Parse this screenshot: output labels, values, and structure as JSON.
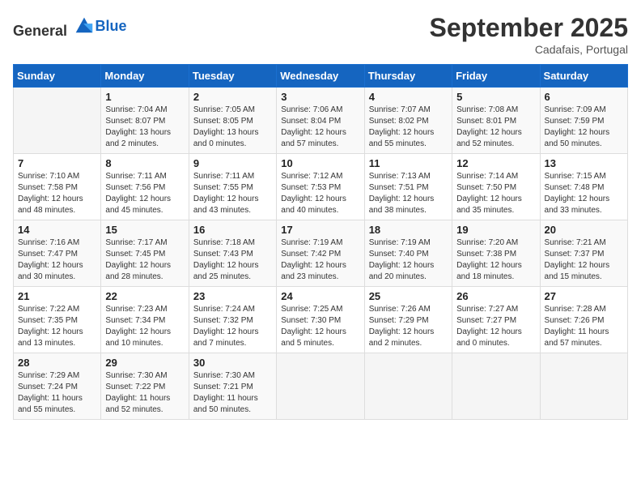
{
  "header": {
    "logo_general": "General",
    "logo_blue": "Blue",
    "month_title": "September 2025",
    "location": "Cadafais, Portugal"
  },
  "weekdays": [
    "Sunday",
    "Monday",
    "Tuesday",
    "Wednesday",
    "Thursday",
    "Friday",
    "Saturday"
  ],
  "weeks": [
    [
      {
        "day": "",
        "info": ""
      },
      {
        "day": "1",
        "info": "Sunrise: 7:04 AM\nSunset: 8:07 PM\nDaylight: 13 hours\nand 2 minutes."
      },
      {
        "day": "2",
        "info": "Sunrise: 7:05 AM\nSunset: 8:05 PM\nDaylight: 13 hours\nand 0 minutes."
      },
      {
        "day": "3",
        "info": "Sunrise: 7:06 AM\nSunset: 8:04 PM\nDaylight: 12 hours\nand 57 minutes."
      },
      {
        "day": "4",
        "info": "Sunrise: 7:07 AM\nSunset: 8:02 PM\nDaylight: 12 hours\nand 55 minutes."
      },
      {
        "day": "5",
        "info": "Sunrise: 7:08 AM\nSunset: 8:01 PM\nDaylight: 12 hours\nand 52 minutes."
      },
      {
        "day": "6",
        "info": "Sunrise: 7:09 AM\nSunset: 7:59 PM\nDaylight: 12 hours\nand 50 minutes."
      }
    ],
    [
      {
        "day": "7",
        "info": "Sunrise: 7:10 AM\nSunset: 7:58 PM\nDaylight: 12 hours\nand 48 minutes."
      },
      {
        "day": "8",
        "info": "Sunrise: 7:11 AM\nSunset: 7:56 PM\nDaylight: 12 hours\nand 45 minutes."
      },
      {
        "day": "9",
        "info": "Sunrise: 7:11 AM\nSunset: 7:55 PM\nDaylight: 12 hours\nand 43 minutes."
      },
      {
        "day": "10",
        "info": "Sunrise: 7:12 AM\nSunset: 7:53 PM\nDaylight: 12 hours\nand 40 minutes."
      },
      {
        "day": "11",
        "info": "Sunrise: 7:13 AM\nSunset: 7:51 PM\nDaylight: 12 hours\nand 38 minutes."
      },
      {
        "day": "12",
        "info": "Sunrise: 7:14 AM\nSunset: 7:50 PM\nDaylight: 12 hours\nand 35 minutes."
      },
      {
        "day": "13",
        "info": "Sunrise: 7:15 AM\nSunset: 7:48 PM\nDaylight: 12 hours\nand 33 minutes."
      }
    ],
    [
      {
        "day": "14",
        "info": "Sunrise: 7:16 AM\nSunset: 7:47 PM\nDaylight: 12 hours\nand 30 minutes."
      },
      {
        "day": "15",
        "info": "Sunrise: 7:17 AM\nSunset: 7:45 PM\nDaylight: 12 hours\nand 28 minutes."
      },
      {
        "day": "16",
        "info": "Sunrise: 7:18 AM\nSunset: 7:43 PM\nDaylight: 12 hours\nand 25 minutes."
      },
      {
        "day": "17",
        "info": "Sunrise: 7:19 AM\nSunset: 7:42 PM\nDaylight: 12 hours\nand 23 minutes."
      },
      {
        "day": "18",
        "info": "Sunrise: 7:19 AM\nSunset: 7:40 PM\nDaylight: 12 hours\nand 20 minutes."
      },
      {
        "day": "19",
        "info": "Sunrise: 7:20 AM\nSunset: 7:38 PM\nDaylight: 12 hours\nand 18 minutes."
      },
      {
        "day": "20",
        "info": "Sunrise: 7:21 AM\nSunset: 7:37 PM\nDaylight: 12 hours\nand 15 minutes."
      }
    ],
    [
      {
        "day": "21",
        "info": "Sunrise: 7:22 AM\nSunset: 7:35 PM\nDaylight: 12 hours\nand 13 minutes."
      },
      {
        "day": "22",
        "info": "Sunrise: 7:23 AM\nSunset: 7:34 PM\nDaylight: 12 hours\nand 10 minutes."
      },
      {
        "day": "23",
        "info": "Sunrise: 7:24 AM\nSunset: 7:32 PM\nDaylight: 12 hours\nand 7 minutes."
      },
      {
        "day": "24",
        "info": "Sunrise: 7:25 AM\nSunset: 7:30 PM\nDaylight: 12 hours\nand 5 minutes."
      },
      {
        "day": "25",
        "info": "Sunrise: 7:26 AM\nSunset: 7:29 PM\nDaylight: 12 hours\nand 2 minutes."
      },
      {
        "day": "26",
        "info": "Sunrise: 7:27 AM\nSunset: 7:27 PM\nDaylight: 12 hours\nand 0 minutes."
      },
      {
        "day": "27",
        "info": "Sunrise: 7:28 AM\nSunset: 7:26 PM\nDaylight: 11 hours\nand 57 minutes."
      }
    ],
    [
      {
        "day": "28",
        "info": "Sunrise: 7:29 AM\nSunset: 7:24 PM\nDaylight: 11 hours\nand 55 minutes."
      },
      {
        "day": "29",
        "info": "Sunrise: 7:30 AM\nSunset: 7:22 PM\nDaylight: 11 hours\nand 52 minutes."
      },
      {
        "day": "30",
        "info": "Sunrise: 7:30 AM\nSunset: 7:21 PM\nDaylight: 11 hours\nand 50 minutes."
      },
      {
        "day": "",
        "info": ""
      },
      {
        "day": "",
        "info": ""
      },
      {
        "day": "",
        "info": ""
      },
      {
        "day": "",
        "info": ""
      }
    ]
  ]
}
